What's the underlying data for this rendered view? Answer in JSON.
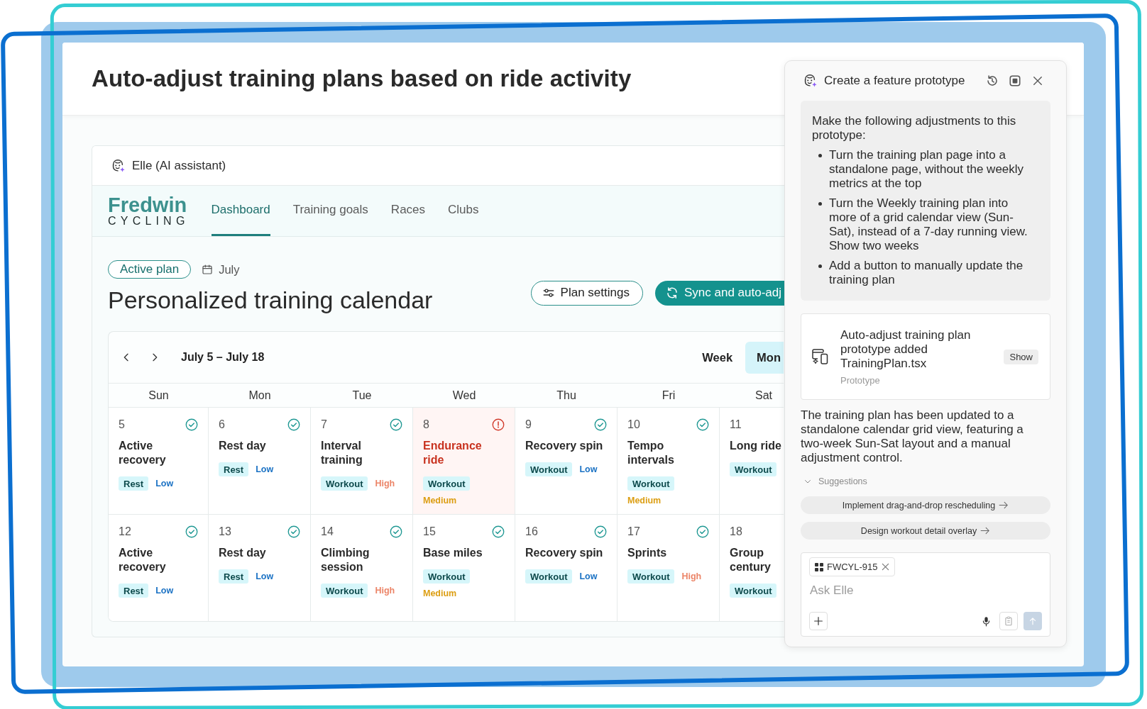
{
  "page": {
    "title": "Auto-adjust training plans based on ride activity"
  },
  "assistant_bar": {
    "label": "Elle (AI assistant)"
  },
  "app": {
    "logo": {
      "name": "Fredwin",
      "tagline": "CYCLING"
    },
    "nav": [
      {
        "label": "Dashboard",
        "selected": true
      },
      {
        "label": "Training goals",
        "selected": false
      },
      {
        "label": "Races",
        "selected": false
      },
      {
        "label": "Clubs",
        "selected": false
      }
    ],
    "plan_badge": "Active plan",
    "month": "July",
    "heading": "Personalized training calendar",
    "actions": [
      {
        "label": "Plan settings",
        "kind": "outline"
      },
      {
        "label": "Sync and auto-adj",
        "kind": "primary"
      }
    ],
    "calendar": {
      "range": "July 5 – July 18",
      "views": [
        {
          "label": "Week",
          "selected": false
        },
        {
          "label": "Mon",
          "selected": true
        }
      ],
      "weekdays": [
        "Sun",
        "Mon",
        "Tue",
        "Wed",
        "Thu",
        "Fri",
        "Sat"
      ],
      "weeks": [
        {
          "days": [
            {
              "date": "5",
              "title": "Active recovery",
              "type": "Rest",
              "intensity": {
                "text": "Low",
                "color": "#1b72c4"
              },
              "warning": false
            },
            {
              "date": "6",
              "title": "Rest day",
              "type": "Rest",
              "intensity": {
                "text": "Low",
                "color": "#1b72c4"
              },
              "warning": false
            },
            {
              "date": "7",
              "title": "Interval training",
              "type": "Workout",
              "intensity": {
                "text": "High",
                "color": "#ec8568"
              },
              "warning": false
            },
            {
              "date": "8",
              "title": "Endurance ride",
              "type": "Workout",
              "intensity": {
                "text": "Medium",
                "color": "#dc9e13"
              },
              "warning": true
            },
            {
              "date": "9",
              "title": "Recovery spin",
              "type": "Workout",
              "intensity": {
                "text": "Low",
                "color": "#1b72c4"
              },
              "warning": false
            },
            {
              "date": "10",
              "title": "Tempo intervals",
              "type": "Workout",
              "intensity": {
                "text": "Medium",
                "color": "#dc9e13"
              },
              "warning": false
            },
            {
              "date": "11",
              "title": "Long ride",
              "type": "Workout"
            }
          ]
        },
        {
          "days": [
            {
              "date": "12",
              "title": "Active recovery",
              "type": "Rest",
              "intensity": {
                "text": "Low",
                "color": "#1b72c4"
              },
              "warning": false
            },
            {
              "date": "13",
              "title": "Rest day",
              "type": "Rest",
              "intensity": {
                "text": "Low",
                "color": "#1b72c4"
              },
              "warning": false
            },
            {
              "date": "14",
              "title": "Climbing session",
              "type": "Workout",
              "intensity": {
                "text": "High",
                "color": "#ec8568"
              },
              "warning": false
            },
            {
              "date": "15",
              "title": "Base miles",
              "type": "Workout",
              "intensity": {
                "text": "Medium",
                "color": "#dc9e13"
              },
              "warning": false
            },
            {
              "date": "16",
              "title": "Recovery spin",
              "type": "Workout",
              "intensity": {
                "text": "Low",
                "color": "#1b72c4"
              },
              "warning": false
            },
            {
              "date": "17",
              "title": "Sprints",
              "type": "Workout",
              "intensity": {
                "text": "High",
                "color": "#ec8568"
              },
              "warning": false
            },
            {
              "date": "18",
              "title": "Group century",
              "type": "Workout"
            }
          ]
        }
      ]
    }
  },
  "panel": {
    "title": "Create a feature prototype",
    "prompt": {
      "intro": "Make the following adjustments to this prototype:",
      "items": [
        "Turn the training plan page into a standalone page, without the weekly metrics at the top",
        "Turn the Weekly training plan into more of a grid calendar view (Sun-Sat), instead of a 7-day running view. Show two weeks",
        "Add a button to manually update the training plan"
      ]
    },
    "artifact": {
      "title": "Auto-adjust training plan prototype added",
      "file": "TrainingPlan.tsx",
      "type": "Prototype",
      "button": "Show"
    },
    "response": "The training plan has been updated to a standalone calendar grid view, featuring a two-week Sun-Sat layout and a manual adjustment control.",
    "suggestions": {
      "label": "Suggestions",
      "expanded": true,
      "items": [
        "Implement drag-and-drop rescheduling",
        "Design workout detail overlay"
      ]
    },
    "composer": {
      "chip": "FWCYL-915",
      "placeholder": "Ask Elle",
      "send_disabled": true
    }
  }
}
